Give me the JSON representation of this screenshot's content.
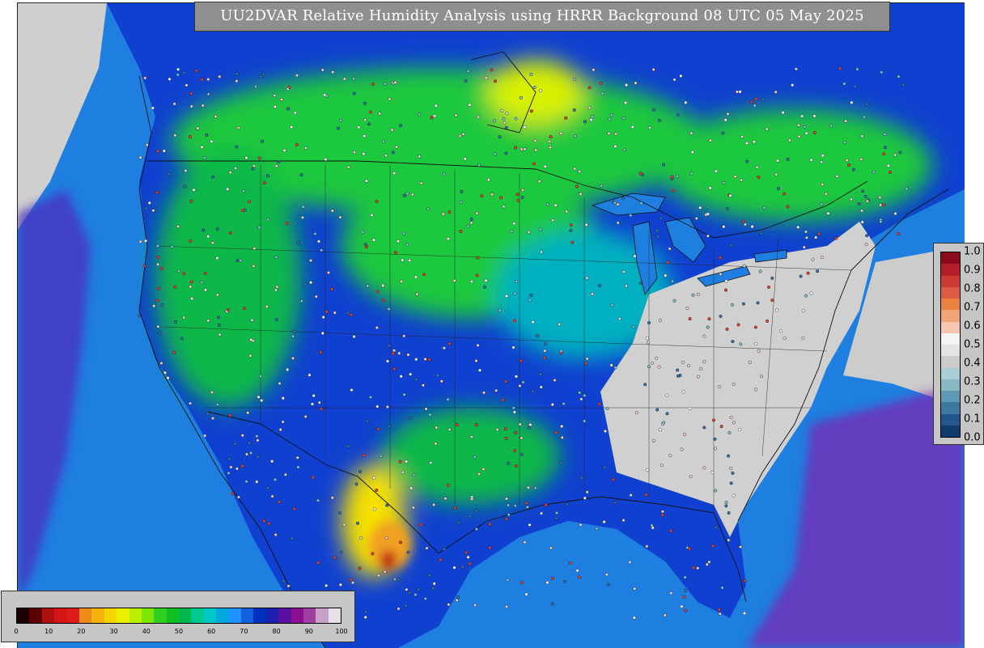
{
  "title": "UU2DVAR Relative Humidity Analysis using HRRR Background 08 UTC 05 May 2025",
  "rh_legend": {
    "ticks": [
      "0",
      "10",
      "20",
      "30",
      "40",
      "50",
      "60",
      "70",
      "80",
      "90",
      "100"
    ],
    "colors": [
      "#1a0000",
      "#5a0000",
      "#b01010",
      "#d41515",
      "#e01a1a",
      "#f08a1a",
      "#f5b20a",
      "#f5d500",
      "#e8f000",
      "#b8f000",
      "#7be600",
      "#30d020",
      "#10c020",
      "#00b84a",
      "#00c890",
      "#00c8c8",
      "#00a8e0",
      "#1e90ff",
      "#1060e0",
      "#0030c0",
      "#2020b0",
      "#5a10a0",
      "#8a1090",
      "#a040a0",
      "#c8a0c8",
      "#e8e0e8"
    ]
  },
  "inc_legend": {
    "ticks": [
      "1.0",
      "0.9",
      "0.8",
      "0.7",
      "0.6",
      "0.5",
      "0.4",
      "0.3",
      "0.2",
      "0.1",
      "0.0"
    ],
    "colors": [
      "#8c0a1e",
      "#b41e28",
      "#cc3c32",
      "#dc5a46",
      "#e8823c",
      "#f0a478",
      "#f6c8b0",
      "#f4f4f4",
      "#e4e4e4",
      "#cccccc",
      "#a8d0d4",
      "#88b8c4",
      "#5e9ab4",
      "#3c78a0",
      "#22568c",
      "#103c6c"
    ]
  },
  "map": {
    "colors": {
      "ocean": "#1e7fe0",
      "land_blue": "#1040d0",
      "land_green": "#1ec83c",
      "land_cyan": "#00b8b8",
      "northeast_gray": "#d0d0d0",
      "purple": "#7010a0",
      "yellow": "#f5e000",
      "orange": "#f0a020",
      "red": "#c01818",
      "boundary": "#111111"
    }
  }
}
